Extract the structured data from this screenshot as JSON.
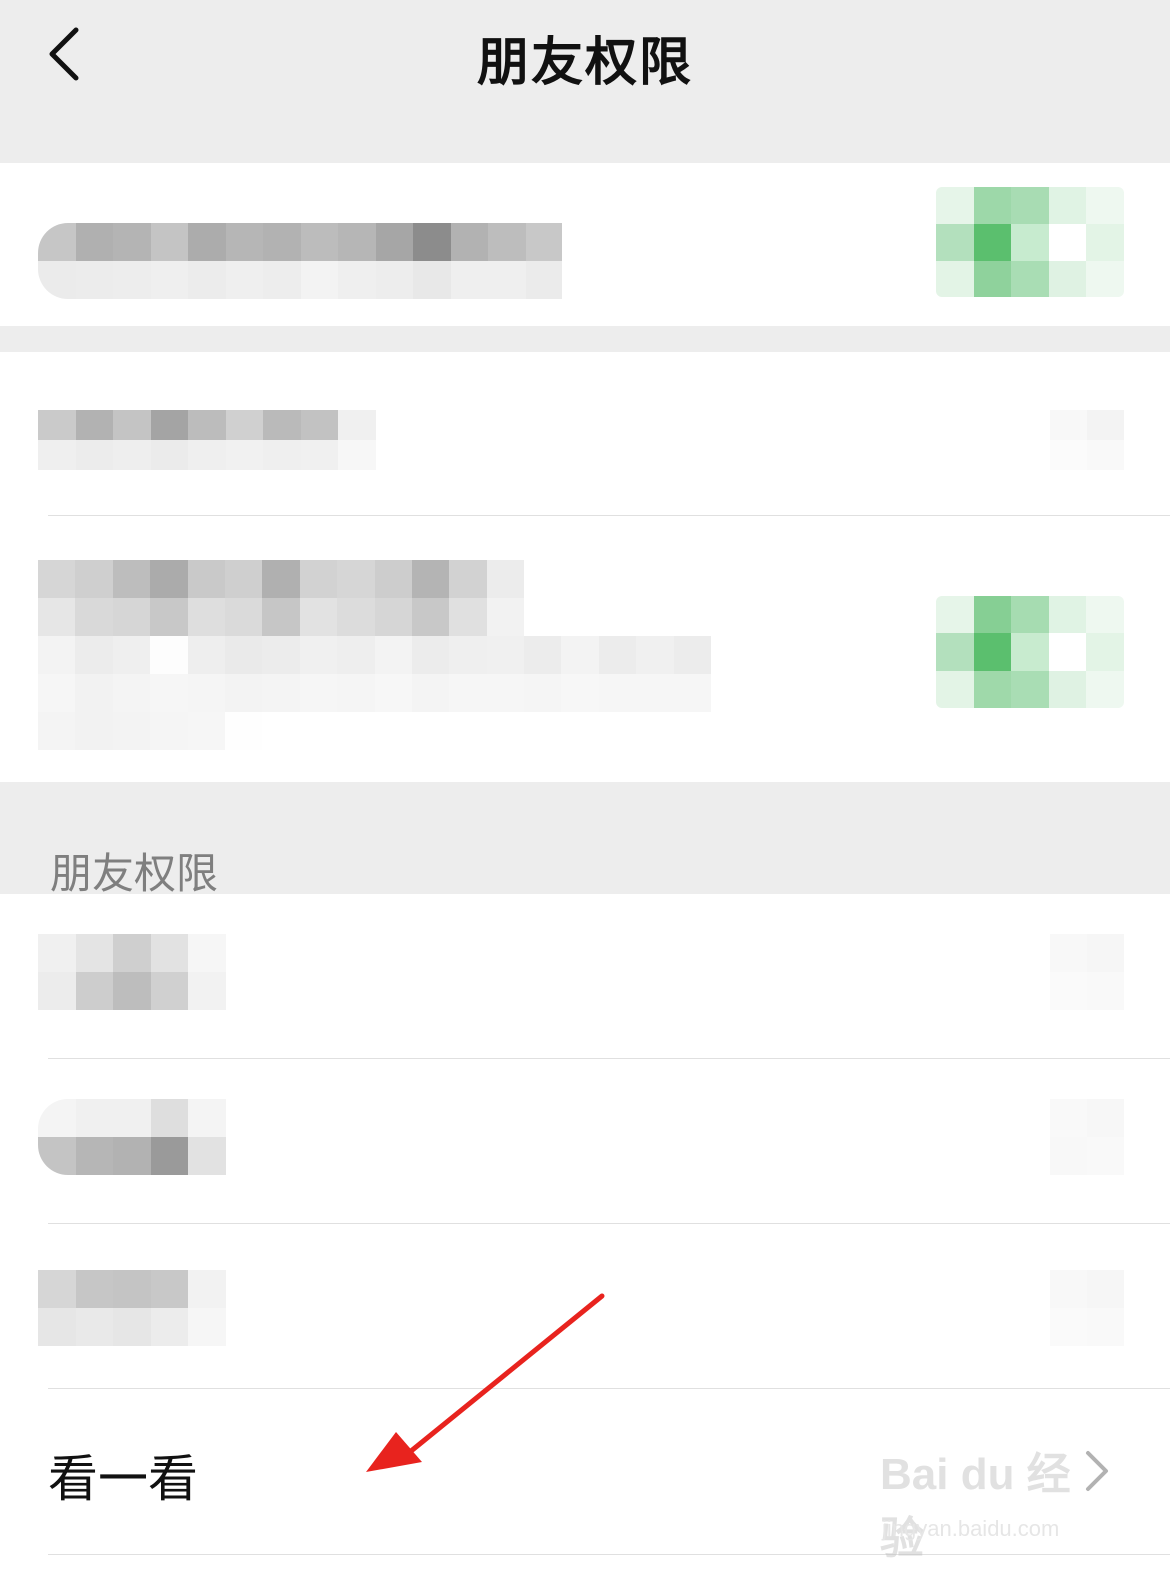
{
  "header": {
    "title": "朋友权限",
    "back_icon": "chevron-left-icon"
  },
  "section": {
    "label": "朋友权限"
  },
  "rows": {
    "look_label": "看一看",
    "look_chevron_icon": "chevron-right-icon"
  },
  "watermark": {
    "brand": "Bai du 经验",
    "url": "jingyan.baidu.com"
  },
  "colors": {
    "background": "#ededed",
    "card": "#ffffff",
    "toggle_green": "#07c160",
    "annotation_arrow": "#e8231e"
  },
  "annotations": {
    "arrow_icon": "red-arrow-icon"
  }
}
